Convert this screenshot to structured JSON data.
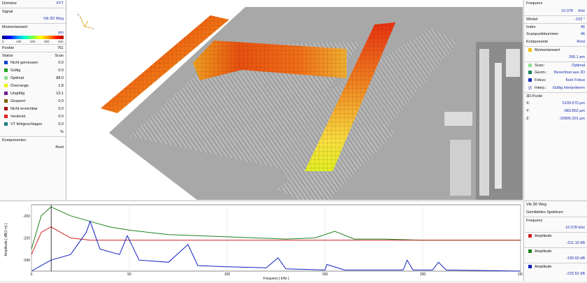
{
  "left_panel": {
    "domain_label": "Domäne",
    "domain_value": "FFT",
    "signal_label": "Signal",
    "signal_value": "Vib 3D Weg",
    "moment_label": "Momentanwert",
    "moment_unit": "pm",
    "colorbar_ticks": [
      "0",
      "100",
      "200",
      "300",
      "400"
    ],
    "points_label": "Punkte",
    "points_value": "761",
    "status_label": "Status",
    "status_col": "Scan",
    "status_items": [
      {
        "label": "Nicht gemessen",
        "value": "0.0",
        "color": "#1040d0"
      },
      {
        "label": "Gültig",
        "value": "0.0",
        "color": "#20a020"
      },
      {
        "label": "Optimal",
        "value": "88.0",
        "color": "#90e090"
      },
      {
        "label": "Overrange",
        "value": "1.8",
        "color": "#f0f000"
      },
      {
        "label": "Ungültig",
        "value": "10.1",
        "color": "#702090"
      },
      {
        "label": "Gesperrt",
        "value": "0.0",
        "color": "#806000"
      },
      {
        "label": "Nicht erreichbar",
        "value": "0.0",
        "color": "#a01010"
      },
      {
        "label": "Verdeckt",
        "value": "0.0",
        "color": "#e02020"
      },
      {
        "label": "VT fehlgeschlagen",
        "value": "0.0",
        "color": "#208080"
      }
    ],
    "percent": "%",
    "components_label": "Komponenten",
    "components_value": "Root"
  },
  "right_panel": {
    "freq_label": "Frequenz",
    "freq_value": "10.078",
    "freq_unit": "kHz",
    "angle_label": "Winkel",
    "angle_value": "-102 °",
    "index_label": "Index",
    "index_value": "46",
    "scanpoint_label": "Scanpunktnummer",
    "scanpoint_value": "46",
    "component_label": "Komponente",
    "component_value": "Root",
    "moment_label": "Momentanwert",
    "moment_value": "266.1 pm",
    "scan_label": "Scan:",
    "scan_value": "Optimal",
    "geom_label": "Geom.:",
    "geom_value": "Berechnet aus 2D",
    "focus_label": "Fokus:",
    "focus_value": "Kein Fokus",
    "interp_label": "Interp.:",
    "interp_value": "Gültig interpolieren",
    "point3d_label": "3D-Punkt",
    "x_label": "X:",
    "x_value": "5109.570 µm",
    "y_label": "Y:",
    "y_value": "-983.862 µm",
    "z_label": "Z:",
    "z_value": "-20906.301 µm"
  },
  "spectrum_panel": {
    "signal_value": "Vib 3D Weg",
    "type_value": "Gemitteltes Spektrum",
    "freq_label": "Frequenz",
    "freq_value": "10.078 kHz",
    "amp_items": [
      {
        "label": "Amplitude",
        "value": "-211.10 dB",
        "color": "#d02020"
      },
      {
        "label": "Amplitude",
        "value": "-190.60 dB",
        "color": "#208020"
      },
      {
        "label": "Amplitude",
        "value": "-233.52 dB",
        "color": "#1020c0"
      }
    ]
  },
  "chart_data": {
    "type": "line",
    "xlabel": "Frequenz [ kHz ]",
    "ylabel": "Amplitude [ dB(1 m) ]",
    "xlim": [
      0,
      250
    ],
    "ylim": [
      -250,
      -190
    ],
    "x_ticks": [
      "0",
      "50",
      "100",
      "150",
      "200",
      "250"
    ],
    "y_ticks": [
      "-200",
      "-220",
      "-240"
    ],
    "cursor_x": 10.078,
    "series": [
      {
        "color": "#208020",
        "x": [
          0,
          5,
          10,
          20,
          30,
          40,
          50,
          70,
          100,
          130,
          145,
          155,
          165,
          180,
          200,
          250
        ],
        "y": [
          -230,
          -200,
          -192,
          -200,
          -205,
          -210,
          -213,
          -217,
          -219,
          -221,
          -220,
          -214,
          -221,
          -221,
          -222,
          -222
        ]
      },
      {
        "color": "#d02020",
        "x": [
          0,
          5,
          10,
          20,
          30,
          50,
          100,
          150,
          200,
          250
        ],
        "y": [
          -235,
          -215,
          -210,
          -220,
          -222,
          -222,
          -222,
          -222,
          -222,
          -222
        ]
      },
      {
        "color": "#1020c0",
        "x": [
          0,
          10,
          20,
          28,
          30,
          35,
          45,
          49,
          55,
          70,
          80,
          85,
          100,
          120,
          126,
          130,
          150,
          151,
          160,
          190,
          192,
          195,
          205,
          208,
          212,
          250
        ],
        "y": [
          -250,
          -240,
          -235,
          -215,
          -205,
          -230,
          -235,
          -218,
          -240,
          -242,
          -226,
          -245,
          -246,
          -247,
          -238,
          -248,
          -249,
          -244,
          -249,
          -249,
          -240,
          -249,
          -249,
          -242,
          -249,
          -250
        ]
      }
    ]
  }
}
